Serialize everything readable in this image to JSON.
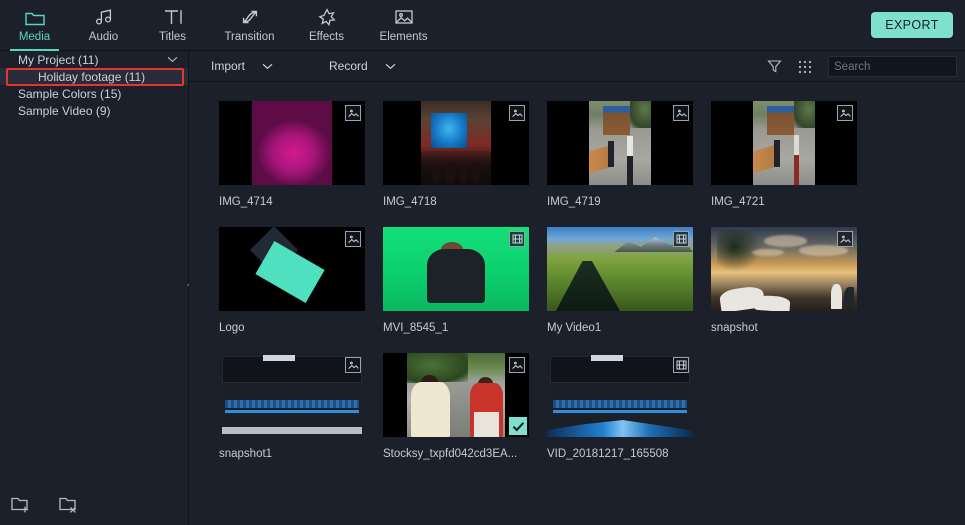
{
  "toolbar": {
    "tabs": [
      {
        "label": "Media",
        "icon": "folder-icon",
        "active": true
      },
      {
        "label": "Audio",
        "icon": "music-note-icon",
        "active": false
      },
      {
        "label": "Titles",
        "icon": "text-t-icon",
        "active": false
      },
      {
        "label": "Transition",
        "icon": "arrows-icon",
        "active": false
      },
      {
        "label": "Effects",
        "icon": "sparkle-icon",
        "active": false
      },
      {
        "label": "Elements",
        "icon": "image-icon",
        "active": false
      }
    ],
    "export_label": "EXPORT",
    "accent_color": "#7fe0cd"
  },
  "sidebar": {
    "items": [
      {
        "label": "My Project (11)",
        "level": 0,
        "expanded": true,
        "selected": false
      },
      {
        "label": "Holiday footage (11)",
        "level": 1,
        "expanded": false,
        "selected": true
      },
      {
        "label": "Sample Colors (15)",
        "level": 0,
        "expanded": false,
        "selected": false
      },
      {
        "label": "Sample Video (9)",
        "level": 0,
        "expanded": false,
        "selected": false
      }
    ],
    "highlight_color": "#e8342a",
    "footer": {
      "new_folder_icon": "folder-plus-icon",
      "delete_folder_icon": "folder-x-icon"
    },
    "collapse_icon": "collapse-left-icon"
  },
  "media_toolbar": {
    "import_label": "Import",
    "import_caret_icon": "chevron-down-icon",
    "record_label": "Record",
    "record_caret_icon": "chevron-down-icon",
    "filter_icon": "funnel-icon",
    "view_grid_icon": "grid-dots-icon",
    "search": {
      "placeholder": "Search",
      "value": "",
      "icon": "search-icon"
    }
  },
  "media_items": [
    {
      "name": "IMG_4714",
      "type": "photo",
      "badge": "image-badge-icon",
      "selected": false,
      "art": "flowers"
    },
    {
      "name": "IMG_4718",
      "type": "photo",
      "badge": "image-badge-icon",
      "selected": false,
      "art": "conference"
    },
    {
      "name": "IMG_4719",
      "type": "photo",
      "badge": "image-badge-icon",
      "selected": false,
      "art": "street"
    },
    {
      "name": "IMG_4721",
      "type": "photo",
      "badge": "image-badge-icon",
      "selected": false,
      "art": "street"
    },
    {
      "name": "Logo",
      "type": "photo",
      "badge": "image-badge-icon",
      "selected": false,
      "art": "logo"
    },
    {
      "name": "MVI_8545_1",
      "type": "video",
      "badge": "film-badge-icon",
      "selected": false,
      "art": "greenscreen"
    },
    {
      "name": "My Video1",
      "type": "video",
      "badge": "film-badge-icon",
      "selected": false,
      "art": "valley"
    },
    {
      "name": "snapshot",
      "type": "photo",
      "badge": "image-badge-icon",
      "selected": false,
      "art": "beach"
    },
    {
      "name": "snapshot1",
      "type": "photo",
      "badge": "image-badge-icon",
      "selected": false,
      "art": "editor"
    },
    {
      "name": "Stocksy_txpfd042cd3EA...",
      "type": "photo",
      "badge": "image-badge-icon",
      "selected": true,
      "art": "stocksy"
    },
    {
      "name": "VID_20181217_165508",
      "type": "video",
      "badge": "film-badge-icon",
      "selected": false,
      "art": "editor"
    }
  ]
}
